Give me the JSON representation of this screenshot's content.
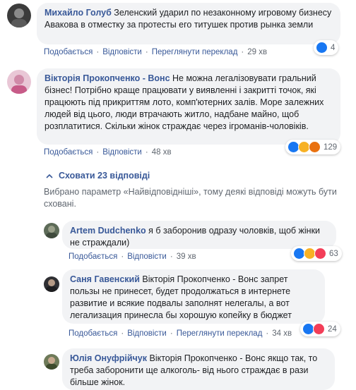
{
  "comments": [
    {
      "author": "Михайло Голуб",
      "text": "Зеленский ударил по незаконному игровому бизнесу Авакова в отместку за протесты его титушек против рынка земли",
      "actions": {
        "like": "Подобається",
        "reply": "Відповісти",
        "translate": "Переглянути переклад",
        "time": "29 хв"
      },
      "reactions": {
        "count": "4",
        "types": [
          "like"
        ]
      }
    },
    {
      "author": "Вікторія Прокопченко - Вонс",
      "text": "Не можна легалізовувати гральний бізнес! Потрібно краще працювати у виявленні і закритті точок, які працюють під прикриттям лото, комп'ютерних залів. Море залежних людей від цього, люди втрачають житло, надбане майно, щоб розплатитися. Скільки жінок страждає через ігроманів-чоловіків.",
      "actions": {
        "like": "Подобається",
        "reply": "Відповісти",
        "time": "48 хв"
      },
      "reactions": {
        "count": "129",
        "types": [
          "like",
          "haha",
          "angry"
        ]
      }
    }
  ],
  "thread": {
    "hide_label": "Сховати 23 відповіді",
    "notice": "Вибрано параметр «Найвідповідніші», тому деякі відповіді можуть бути сховані."
  },
  "replies": [
    {
      "author": "Artem Dudchenko",
      "text": "я б заборонив одразу чоловків, щоб жінки не страждали)",
      "actions": {
        "like": "Подобається",
        "reply": "Відповісти",
        "time": "39 хв"
      },
      "reactions": {
        "count": "63",
        "types": [
          "like",
          "haha",
          "love"
        ]
      }
    },
    {
      "author": "Саня Гавенский",
      "mention": "Вікторія Прокопченко - Вонс",
      "text": "запрет пользы не принесет, будет продолжаться в интернете развитие и всякие подвалы заполнят нелегалы, а вот легализация принесла бы хорошую копейку в бюджет",
      "actions": {
        "like": "Подобається",
        "reply": "Відповісти",
        "translate": "Переглянути переклад",
        "time": "34 хв"
      },
      "reactions": {
        "count": "24",
        "types": [
          "like",
          "love"
        ]
      }
    },
    {
      "author": "Юлія Онуфрійчук",
      "mention": "Вікторія Прокопченко - Вонс",
      "text": "якщо так, то треба заборонити ще алкоголь- від нього страждає в рази більше жінок."
    }
  ],
  "colors": {
    "link": "#385898",
    "bubble": "#f2f3f5",
    "meta": "#606770",
    "like": "#1877f2"
  },
  "icons": [
    "like-icon",
    "haha-icon",
    "angry-icon",
    "love-icon",
    "chevron-up-icon"
  ]
}
